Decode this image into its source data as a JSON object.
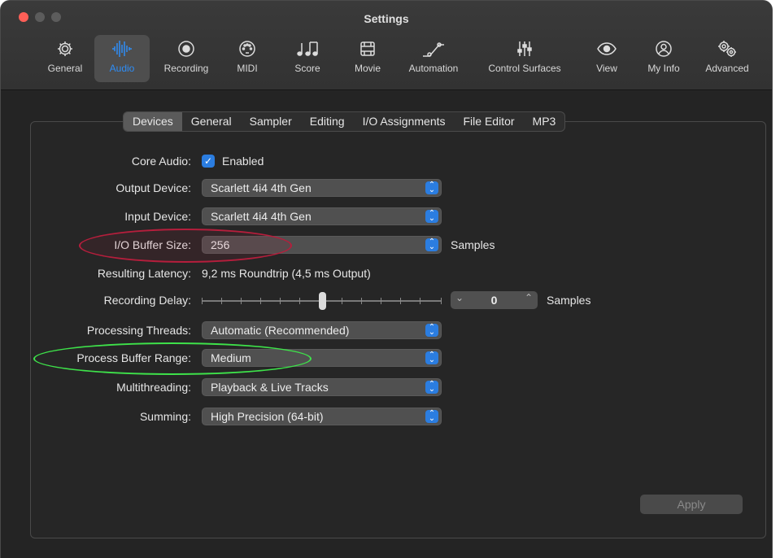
{
  "window": {
    "title": "Settings"
  },
  "toolbar": [
    {
      "label": "General",
      "icon": "gear-icon"
    },
    {
      "label": "Audio",
      "icon": "waveform-icon",
      "active": true
    },
    {
      "label": "Recording",
      "icon": "record-icon"
    },
    {
      "label": "MIDI",
      "icon": "midi-port-icon"
    },
    {
      "label": "Score",
      "icon": "music-notes-icon"
    },
    {
      "label": "Movie",
      "icon": "film-icon"
    },
    {
      "label": "Automation",
      "icon": "automation-curve-icon"
    },
    {
      "label": "Control Surfaces",
      "icon": "faders-icon"
    },
    {
      "label": "View",
      "icon": "eye-icon"
    },
    {
      "label": "My Info",
      "icon": "person-icon"
    },
    {
      "label": "Advanced",
      "icon": "gears-icon"
    }
  ],
  "tabs": [
    "Devices",
    "General",
    "Sampler",
    "Editing",
    "I/O Assignments",
    "File Editor",
    "MP3"
  ],
  "active_tab": "Devices",
  "settings": {
    "core_audio": {
      "label": "Core Audio:",
      "checkbox_label": "Enabled",
      "checked": true
    },
    "output_device": {
      "label": "Output Device:",
      "value": "Scarlett 4i4 4th Gen"
    },
    "input_device": {
      "label": "Input Device:",
      "value": "Scarlett 4i4 4th Gen"
    },
    "io_buffer_size": {
      "label": "I/O Buffer Size:",
      "value": "256",
      "unit": "Samples"
    },
    "resulting_latency": {
      "label": "Resulting Latency:",
      "value": "9,2 ms Roundtrip (4,5 ms Output)"
    },
    "recording_delay": {
      "label": "Recording Delay:",
      "value": "0",
      "unit": "Samples"
    },
    "processing_threads": {
      "label": "Processing Threads:",
      "value": "Automatic (Recommended)"
    },
    "process_buffer_range": {
      "label": "Process Buffer Range:",
      "value": "Medium"
    },
    "multithreading": {
      "label": "Multithreading:",
      "value": "Playback & Live Tracks"
    },
    "summing": {
      "label": "Summing:",
      "value": "High Precision (64-bit)"
    }
  },
  "apply_label": "Apply",
  "colors": {
    "accent": "#2b7de0",
    "highlight_red": "#b51e3c",
    "highlight_green": "#3ee24a"
  }
}
